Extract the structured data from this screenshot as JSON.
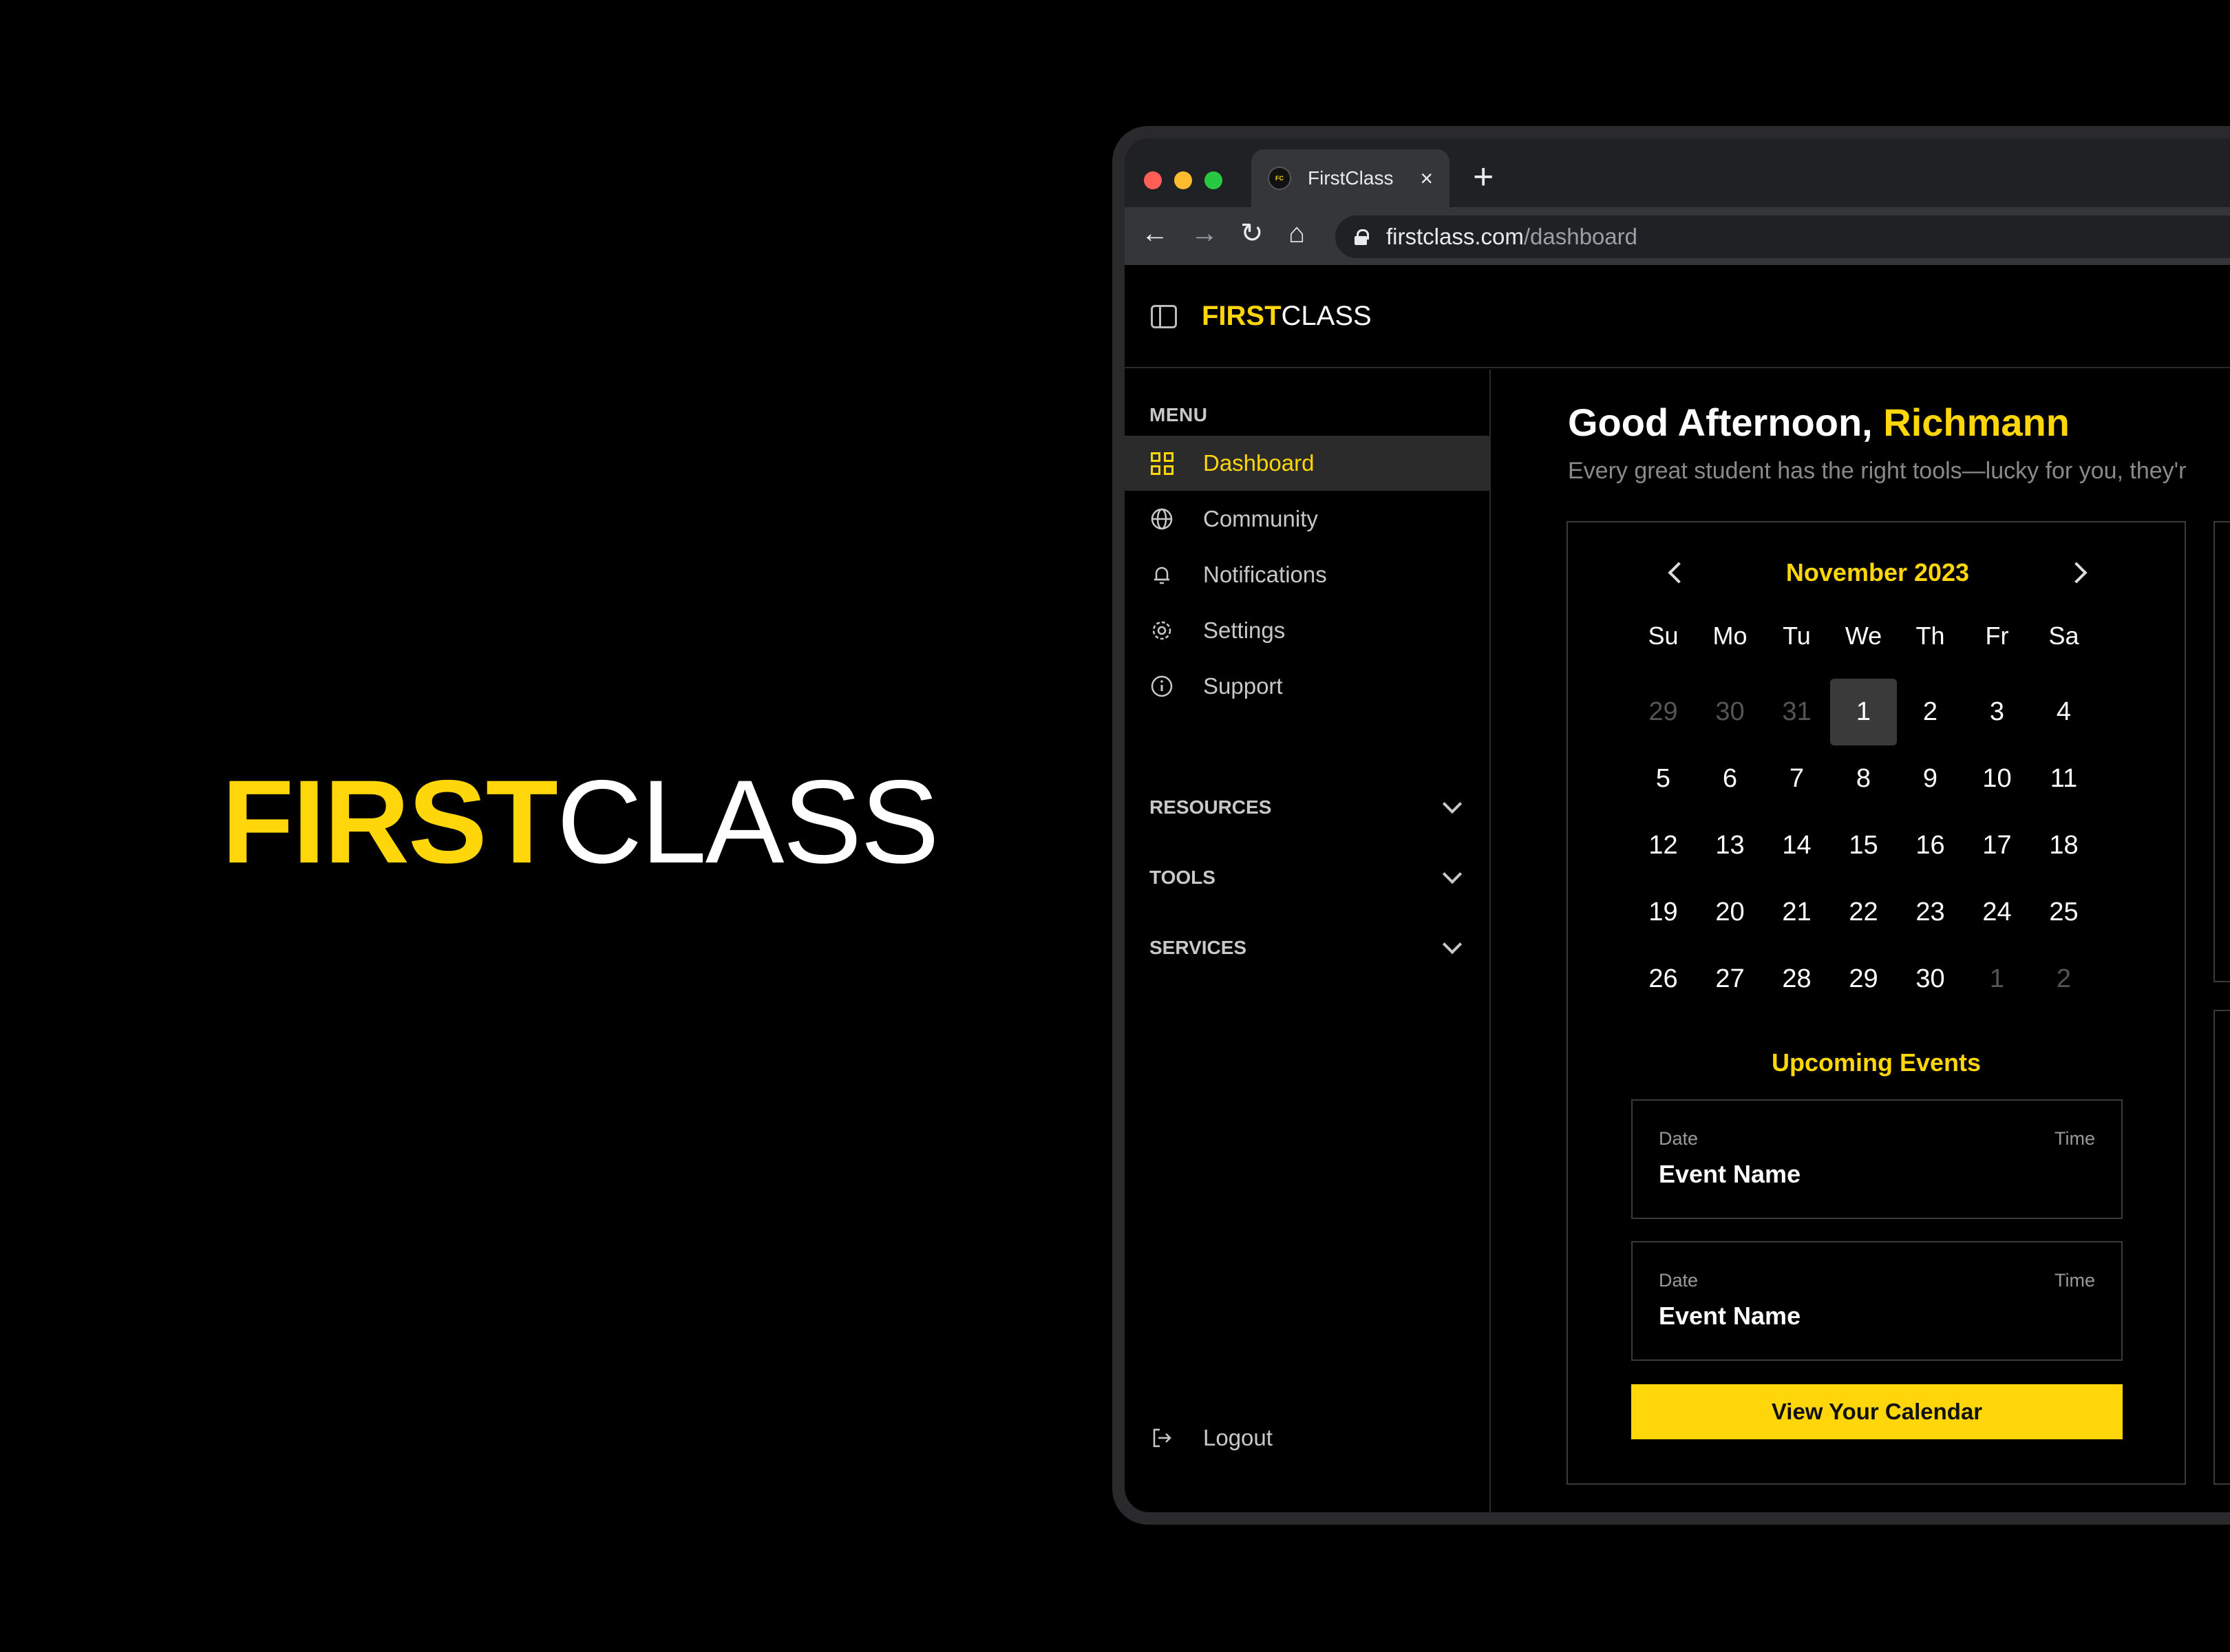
{
  "brand": {
    "first": "FIRST",
    "class": "CLASS"
  },
  "browser": {
    "tab_title": "FirstClass",
    "tab_close": "×",
    "new_tab": "+",
    "url_host": "firstclass.com",
    "url_path": "/dashboard",
    "back": "←",
    "forward": "→",
    "reload": "↻",
    "home": "⌂"
  },
  "sidebar": {
    "menu_label": "MENU",
    "items": [
      {
        "label": "Dashboard",
        "icon": "dashboard-icon",
        "active": true
      },
      {
        "label": "Community",
        "icon": "globe-icon"
      },
      {
        "label": "Notifications",
        "icon": "bell-icon"
      },
      {
        "label": "Settings",
        "icon": "gear-icon"
      },
      {
        "label": "Support",
        "icon": "info-icon"
      }
    ],
    "sections": [
      "RESOURCES",
      "TOOLS",
      "SERVICES"
    ],
    "logout": "Logout"
  },
  "main": {
    "greeting": "Good Afternoon, ",
    "user_name": "Richmann",
    "subtitle": "Every great student has the right tools—lucky for you, they'r"
  },
  "calendar": {
    "month": "November 2023",
    "weekdays": [
      "Su",
      "Mo",
      "Tu",
      "We",
      "Th",
      "Fr",
      "Sa"
    ],
    "days": [
      {
        "d": "29",
        "m": true
      },
      {
        "d": "30",
        "m": true
      },
      {
        "d": "31",
        "m": true
      },
      {
        "d": "1",
        "s": true
      },
      {
        "d": "2"
      },
      {
        "d": "3"
      },
      {
        "d": "4"
      },
      {
        "d": "5"
      },
      {
        "d": "6"
      },
      {
        "d": "7"
      },
      {
        "d": "8"
      },
      {
        "d": "9"
      },
      {
        "d": "10"
      },
      {
        "d": "11"
      },
      {
        "d": "12"
      },
      {
        "d": "13"
      },
      {
        "d": "14"
      },
      {
        "d": "15"
      },
      {
        "d": "16"
      },
      {
        "d": "17"
      },
      {
        "d": "18"
      },
      {
        "d": "19"
      },
      {
        "d": "20"
      },
      {
        "d": "21"
      },
      {
        "d": "22"
      },
      {
        "d": "23"
      },
      {
        "d": "24"
      },
      {
        "d": "25"
      },
      {
        "d": "26"
      },
      {
        "d": "27"
      },
      {
        "d": "28"
      },
      {
        "d": "29"
      },
      {
        "d": "30"
      },
      {
        "d": "1",
        "m": true
      },
      {
        "d": "2",
        "m": true
      }
    ]
  },
  "events": {
    "title": "Upcoming Events",
    "items": [
      {
        "date": "Date",
        "time": "Time",
        "name": "Event Name"
      },
      {
        "date": "Date",
        "time": "Time",
        "name": "Event Name"
      }
    ],
    "button": "View Your Calendar"
  },
  "colors": {
    "accent": "#FFD60A",
    "background": "#000000",
    "surface": "#2b2b2b"
  }
}
